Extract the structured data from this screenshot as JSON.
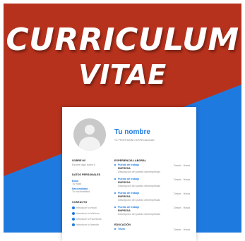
{
  "colors": {
    "red": "#b7321d",
    "blue": "#1f7ae0",
    "white": "#ffffff"
  },
  "headline": {
    "line1": "CURRICULUM",
    "line2": "VITAE"
  },
  "cv": {
    "name": "Tu nombre",
    "profession": "TU PROFESIÓN O ESPECIALIDAD",
    "about": {
      "title": "SOBRE MÍ",
      "text": "Escribe algo sobre ti"
    },
    "personal": {
      "title": "DATOS PERSONALES",
      "age_label": "Edad",
      "age_value": "Tu edad",
      "nationality_label": "Nacionalidad",
      "nationality_value": "Tu nacionalidad"
    },
    "contact": {
      "title": "CONTACTO",
      "items": [
        "Introduce tu email",
        "Introduce tu teléfono",
        "Introduce tu Facebook",
        "Introduce tu linkedin"
      ]
    },
    "experience": {
      "title": "EXPERIENCIA LABORAL",
      "items": [
        {
          "role": "Puesto de trabajo",
          "company": "EMPRESA",
          "desc": "Descripción del puesto desempeñado",
          "dates": "Desde - Hasta"
        },
        {
          "role": "Puesto de trabajo",
          "company": "EMPRESA",
          "desc": "Descripción del puesto desempeñado",
          "dates": "Desde - Hasta"
        },
        {
          "role": "Puesto de trabajo",
          "company": "EMPRESA",
          "desc": "Descripción del puesto desempeñado",
          "dates": "Desde - Hasta"
        },
        {
          "role": "Puesto de trabajo",
          "company": "EMPRESA",
          "desc": "Descripción del puesto desempeñado",
          "dates": "Desde - Hasta"
        }
      ]
    },
    "education": {
      "title": "EDUCACIÓN",
      "items": [
        {
          "role": "Título",
          "dates": "Desde - Hasta"
        }
      ]
    }
  }
}
